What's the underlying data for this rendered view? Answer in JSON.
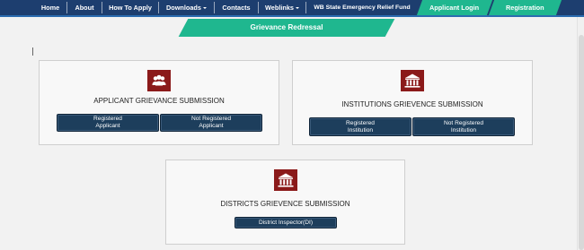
{
  "nav": {
    "items": [
      {
        "label": "Home"
      },
      {
        "label": "About"
      },
      {
        "label": "How To Apply"
      },
      {
        "label": "Downloads"
      },
      {
        "label": "Contacts"
      },
      {
        "label": "Weblinks"
      },
      {
        "label": "WB State Emergency Relief Fund"
      }
    ],
    "applicant_login": "Applicant Login",
    "registration": "Registration"
  },
  "banner": {
    "title": "Grievance Redressal"
  },
  "cards": {
    "applicant": {
      "title": "APPLICANT GRIEVANCE SUBMISSION",
      "btn_registered": "Registered\nApplicant",
      "btn_not_registered": "Not Registered\nApplicant"
    },
    "institutions": {
      "title": "INSTITUTIONS GRIEVENCE SUBMISSION",
      "btn_registered": "Registered\nInstitution",
      "btn_not_registered": "Not Registered\nInstitution"
    },
    "districts": {
      "title": "DISTRICTS GRIEVENCE SUBMISSION",
      "btn_inspector": "District Inspector(DI)"
    }
  },
  "colors": {
    "nav_bg": "#1d3e6f",
    "accent_green": "#1fb78f",
    "icon_red": "#8b1a1a",
    "button_navy": "#1d3e5c"
  },
  "icons": {
    "applicant": "users-icon",
    "institutions": "institution-building-icon",
    "districts": "institution-building-icon"
  }
}
